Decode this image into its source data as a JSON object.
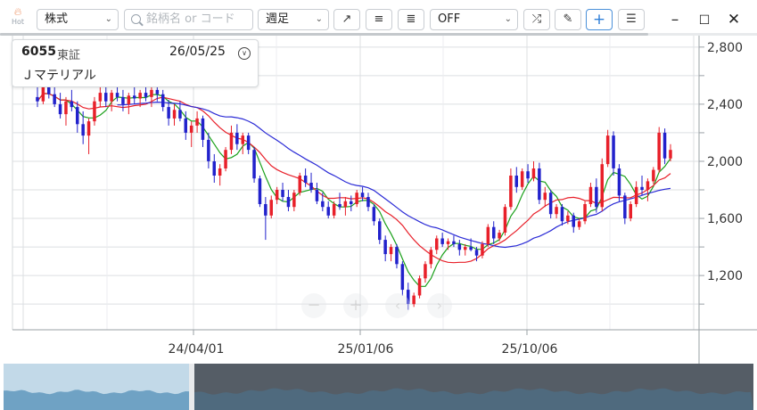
{
  "toolbar": {
    "hot_label": "Hot",
    "category_select": "株式",
    "search_placeholder": "銘柄名 or コード",
    "period_select": "週足",
    "indicator_select": "OFF"
  },
  "info_popup": {
    "code": "6055",
    "market": "東証",
    "date": "26/05/25",
    "name": "Ｊマテリアル"
  },
  "chart_data": {
    "type": "candlestick",
    "title": "",
    "x_tick_labels": [
      "24/04/01",
      "25/01/06",
      "25/10/06"
    ],
    "y_tick_labels": [
      "1,200",
      "1,600",
      "2,000",
      "2,400",
      "2,800"
    ],
    "y_ticks": [
      1200,
      1600,
      2000,
      2400,
      2800
    ],
    "ylim": [
      820,
      2880
    ],
    "grid": true,
    "x_axis": {
      "first_week": "23/07/24",
      "last_week": "26/05/25",
      "interval": "weekly"
    },
    "candle_colors": {
      "up": "#e8202a",
      "down": "#2222cc"
    },
    "moving_averages": [
      {
        "color": "#1aa01a"
      },
      {
        "color": "#e8202a"
      },
      {
        "color": "#2b2bd6"
      }
    ],
    "candles": [
      [
        2450,
        2520,
        2380,
        2420
      ],
      [
        2420,
        2560,
        2400,
        2530
      ],
      [
        2530,
        2600,
        2440,
        2470
      ],
      [
        2470,
        2520,
        2380,
        2400
      ],
      [
        2400,
        2480,
        2300,
        2330
      ],
      [
        2330,
        2450,
        2250,
        2420
      ],
      [
        2420,
        2500,
        2350,
        2380
      ],
      [
        2380,
        2420,
        2200,
        2260
      ],
      [
        2260,
        2350,
        2120,
        2180
      ],
      [
        2180,
        2300,
        2050,
        2280
      ],
      [
        2280,
        2450,
        2250,
        2420
      ],
      [
        2420,
        2520,
        2380,
        2480
      ],
      [
        2480,
        2530,
        2380,
        2420
      ],
      [
        2420,
        2500,
        2350,
        2480
      ],
      [
        2480,
        2560,
        2420,
        2450
      ],
      [
        2450,
        2500,
        2350,
        2400
      ],
      [
        2400,
        2480,
        2330,
        2460
      ],
      [
        2460,
        2530,
        2400,
        2440
      ],
      [
        2440,
        2500,
        2380,
        2480
      ],
      [
        2480,
        2560,
        2420,
        2450
      ],
      [
        2450,
        2520,
        2380,
        2500
      ],
      [
        2500,
        2550,
        2420,
        2470
      ],
      [
        2470,
        2500,
        2350,
        2380
      ],
      [
        2380,
        2430,
        2250,
        2300
      ],
      [
        2300,
        2400,
        2250,
        2360
      ],
      [
        2360,
        2420,
        2280,
        2300
      ],
      [
        2300,
        2350,
        2150,
        2200
      ],
      [
        2200,
        2280,
        2100,
        2250
      ],
      [
        2250,
        2350,
        2200,
        2300
      ],
      [
        2300,
        2320,
        2100,
        2150
      ],
      [
        2150,
        2200,
        1950,
        2000
      ],
      [
        2000,
        2050,
        1850,
        1900
      ],
      [
        1900,
        1980,
        1830,
        1950
      ],
      [
        1950,
        2100,
        1930,
        2080
      ],
      [
        2080,
        2250,
        2050,
        2200
      ],
      [
        2200,
        2260,
        2080,
        2120
      ],
      [
        2120,
        2200,
        2050,
        2180
      ],
      [
        2180,
        2200,
        2050,
        2080
      ],
      [
        2080,
        2100,
        1850,
        1880
      ],
      [
        1880,
        1900,
        1680,
        1700
      ],
      [
        1700,
        1750,
        1450,
        1620
      ],
      [
        1620,
        1760,
        1600,
        1730
      ],
      [
        1730,
        1820,
        1700,
        1800
      ],
      [
        1800,
        1850,
        1720,
        1750
      ],
      [
        1750,
        1800,
        1650,
        1680
      ],
      [
        1680,
        1800,
        1650,
        1780
      ],
      [
        1780,
        1920,
        1760,
        1900
      ],
      [
        1900,
        1950,
        1820,
        1850
      ],
      [
        1850,
        1920,
        1780,
        1800
      ],
      [
        1800,
        1850,
        1700,
        1720
      ],
      [
        1720,
        1780,
        1650,
        1680
      ],
      [
        1680,
        1720,
        1600,
        1620
      ],
      [
        1620,
        1720,
        1600,
        1700
      ],
      [
        1700,
        1780,
        1660,
        1680
      ],
      [
        1680,
        1750,
        1620,
        1720
      ],
      [
        1720,
        1760,
        1650,
        1700
      ],
      [
        1700,
        1800,
        1680,
        1780
      ],
      [
        1780,
        1820,
        1720,
        1750
      ],
      [
        1750,
        1780,
        1650,
        1680
      ],
      [
        1680,
        1700,
        1550,
        1580
      ],
      [
        1580,
        1600,
        1420,
        1450
      ],
      [
        1450,
        1480,
        1300,
        1350
      ],
      [
        1350,
        1420,
        1300,
        1400
      ],
      [
        1400,
        1420,
        1250,
        1280
      ],
      [
        1280,
        1300,
        1060,
        1100
      ],
      [
        1100,
        1150,
        960,
        1000
      ],
      [
        1000,
        1080,
        980,
        1060
      ],
      [
        1060,
        1200,
        1040,
        1180
      ],
      [
        1180,
        1300,
        1150,
        1280
      ],
      [
        1280,
        1400,
        1250,
        1380
      ],
      [
        1380,
        1480,
        1350,
        1460
      ],
      [
        1460,
        1500,
        1400,
        1420
      ],
      [
        1420,
        1460,
        1380,
        1440
      ],
      [
        1440,
        1480,
        1400,
        1420
      ],
      [
        1420,
        1450,
        1340,
        1380
      ],
      [
        1380,
        1420,
        1340,
        1400
      ],
      [
        1400,
        1460,
        1370,
        1380
      ],
      [
        1380,
        1400,
        1300,
        1340
      ],
      [
        1340,
        1440,
        1320,
        1420
      ],
      [
        1420,
        1560,
        1400,
        1540
      ],
      [
        1540,
        1580,
        1420,
        1460
      ],
      [
        1460,
        1520,
        1440,
        1500
      ],
      [
        1500,
        1700,
        1480,
        1680
      ],
      [
        1680,
        1950,
        1660,
        1900
      ],
      [
        1900,
        1960,
        1780,
        1820
      ],
      [
        1820,
        1950,
        1800,
        1930
      ],
      [
        1930,
        1980,
        1850,
        1880
      ],
      [
        1880,
        2000,
        1860,
        1950
      ],
      [
        1950,
        1990,
        1700,
        1730
      ],
      [
        1730,
        1820,
        1680,
        1780
      ],
      [
        1780,
        1800,
        1600,
        1630
      ],
      [
        1630,
        1700,
        1600,
        1680
      ],
      [
        1680,
        1700,
        1550,
        1580
      ],
      [
        1580,
        1650,
        1560,
        1620
      ],
      [
        1620,
        1640,
        1500,
        1540
      ],
      [
        1540,
        1600,
        1520,
        1580
      ],
      [
        1580,
        1720,
        1560,
        1700
      ],
      [
        1700,
        1850,
        1680,
        1820
      ],
      [
        1820,
        1880,
        1640,
        1680
      ],
      [
        1680,
        2020,
        1650,
        1980
      ],
      [
        1980,
        2220,
        1960,
        2180
      ],
      [
        2180,
        2210,
        1900,
        1950
      ],
      [
        1950,
        1980,
        1720,
        1760
      ],
      [
        1760,
        1780,
        1560,
        1600
      ],
      [
        1600,
        1720,
        1580,
        1700
      ],
      [
        1700,
        1860,
        1680,
        1820
      ],
      [
        1820,
        1900,
        1760,
        1800
      ],
      [
        1800,
        1880,
        1720,
        1860
      ],
      [
        1860,
        1960,
        1840,
        1940
      ],
      [
        1940,
        2240,
        1920,
        2200
      ],
      [
        2200,
        2230,
        1980,
        2020
      ],
      [
        2020,
        2120,
        2000,
        2080
      ]
    ]
  }
}
